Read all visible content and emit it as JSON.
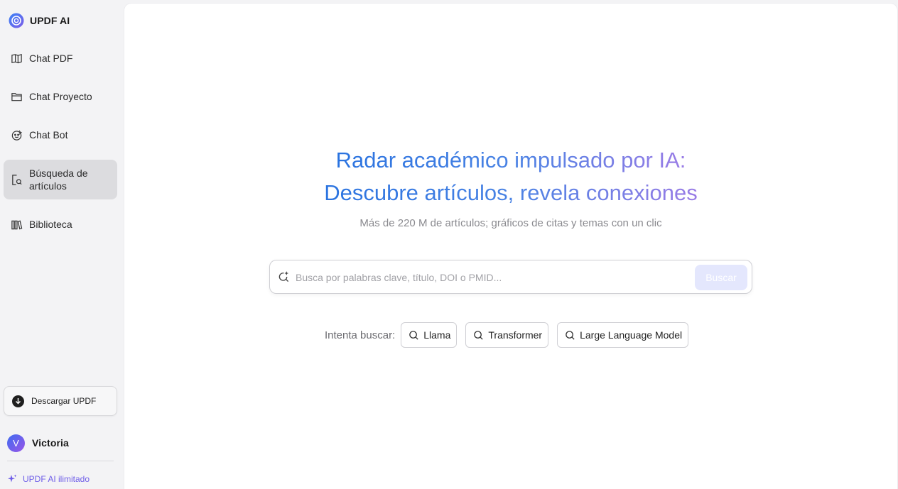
{
  "brand": {
    "name": "UPDF AI",
    "logo_icon": "updf-ai-logo-icon"
  },
  "sidebar": {
    "items": [
      {
        "label": "Chat PDF",
        "icon": "book-open-icon"
      },
      {
        "label": "Chat Proyecto",
        "icon": "folder-icon"
      },
      {
        "label": "Chat Bot",
        "icon": "bot-face-icon"
      },
      {
        "label": "Búsqueda de artículos",
        "icon": "document-search-icon",
        "active": true
      },
      {
        "label": "Biblioteca",
        "icon": "library-icon"
      }
    ],
    "download_label": "Descargar UPDF",
    "user": {
      "initial": "V",
      "name": "Victoria"
    },
    "upgrade_label": "UPDF AI ilimitado"
  },
  "main": {
    "title_line1": "Radar académico impulsado por IA:",
    "title_line2": "Descubre artículos, revela conexiones",
    "subtitle": "Más de 220 M de artículos; gráficos de citas y temas con un clic",
    "search": {
      "placeholder": "Busca por palabras clave, título, DOI o PMID...",
      "value": "",
      "button_label": "Buscar"
    },
    "suggestions_label": "Intenta buscar:",
    "suggestions": [
      "Llama",
      "Transformer",
      "Large Language Model"
    ]
  },
  "colors": {
    "accent_blue": "#2a73e0",
    "accent_purple": "#9a7ce6",
    "upgrade_purple": "#6f5ee8",
    "active_nav_bg": "#dcdcdf"
  }
}
